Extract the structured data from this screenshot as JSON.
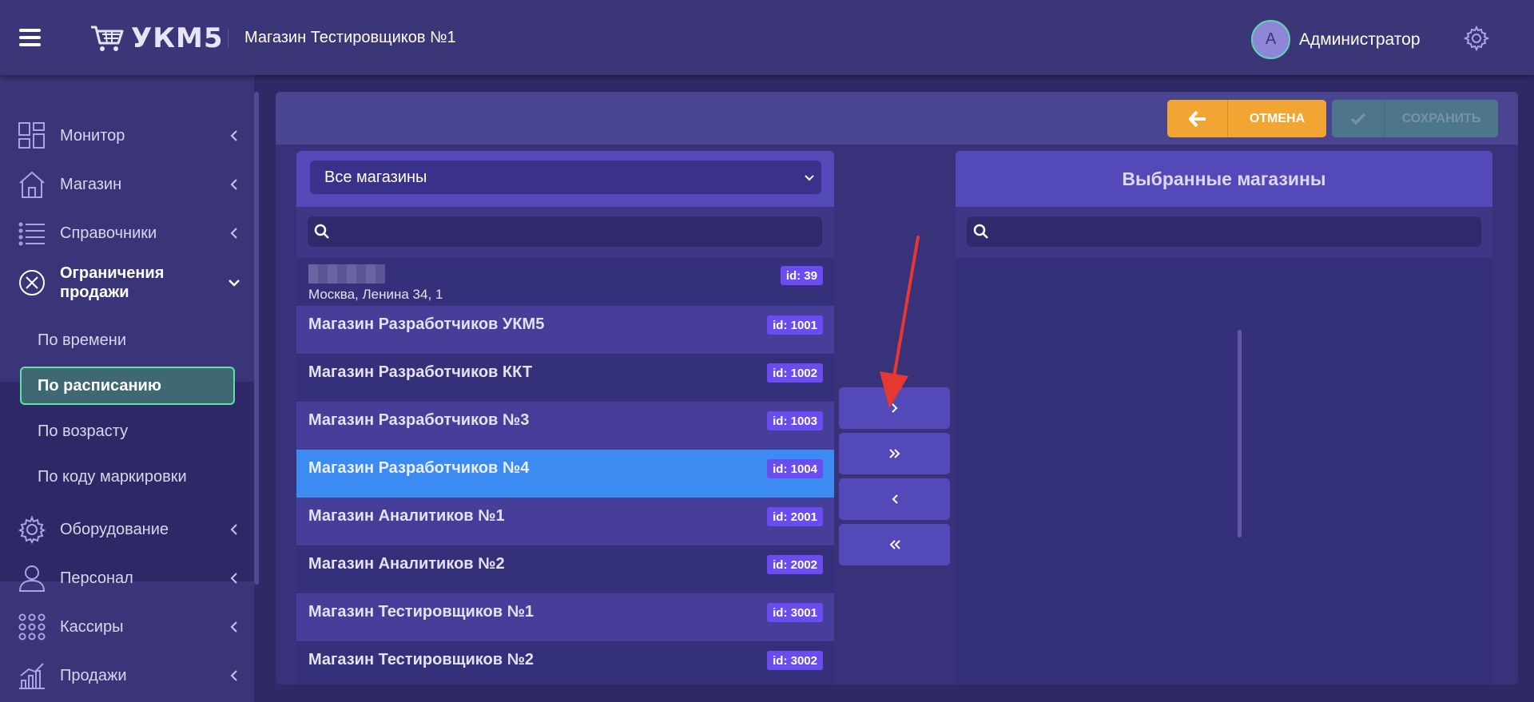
{
  "header": {
    "logo_text": "УКМ5",
    "store_name": "Магазин Тестировщиков №1",
    "user_initial": "А",
    "user_name": "Администратор"
  },
  "sidebar": {
    "items": [
      {
        "label": "Монитор",
        "icon": "dashboard-icon"
      },
      {
        "label": "Магазин",
        "icon": "store-icon"
      },
      {
        "label": "Справочники",
        "icon": "list-icon"
      },
      {
        "label": "Ограничения продажи",
        "icon": "restriction-icon"
      },
      {
        "label": "Оборудование",
        "icon": "gear-icon"
      },
      {
        "label": "Персонал",
        "icon": "user-icon"
      },
      {
        "label": "Кассиры",
        "icon": "grid-dots-icon"
      },
      {
        "label": "Продажи",
        "icon": "chart-icon"
      }
    ],
    "subitems": [
      {
        "label": "По времени",
        "active": false
      },
      {
        "label": "По расписанию",
        "active": true
      },
      {
        "label": "По возрасту",
        "active": false
      },
      {
        "label": "По коду маркировки",
        "active": false
      }
    ]
  },
  "toolbar": {
    "cancel_label": "ОТМЕНА",
    "save_label": "СОХРАНИТЬ"
  },
  "left_panel": {
    "filter_value": "Все магазины",
    "search_placeholder": "",
    "rows": [
      {
        "name": "",
        "address": "Москва, Ленина 34, 1",
        "id": "id: 39"
      },
      {
        "name": "Магазин Разработчиков УКМ5",
        "id": "id: 1001"
      },
      {
        "name": "Магазин Разработчиков ККТ",
        "id": "id: 1002"
      },
      {
        "name": "Магазин Разработчиков №3",
        "id": "id: 1003"
      },
      {
        "name": "Магазин Разработчиков №4",
        "id": "id: 1004",
        "selected": true
      },
      {
        "name": "Магазин Аналитиков №1",
        "id": "id: 2001"
      },
      {
        "name": "Магазин Аналитиков №2",
        "id": "id: 2002"
      },
      {
        "name": "Магазин Тестировщиков №1",
        "id": "id: 3001"
      },
      {
        "name": "Магазин Тестировщиков №2",
        "id": "id: 3002"
      }
    ]
  },
  "right_panel": {
    "title": "Выбранные магазины",
    "search_placeholder": ""
  },
  "colors": {
    "accent_orange": "#f2a532",
    "selected_row": "#3b8bf2",
    "badge": "#6a4cf0",
    "active_border": "#5fe3a4"
  }
}
